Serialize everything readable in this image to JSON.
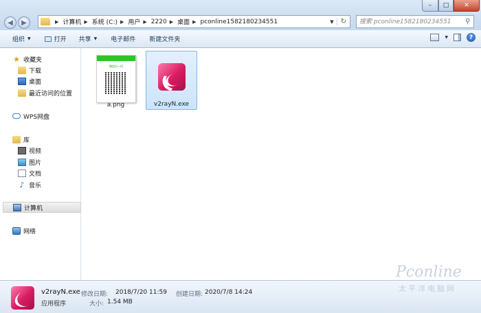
{
  "window": {
    "controls": {
      "minimize": "–",
      "maximize": "□",
      "close": "✕"
    }
  },
  "address_bar": {
    "crumbs": [
      "计算机",
      "系统 (C:)",
      "用户",
      "2220",
      "桌面",
      "pconline1582180234551"
    ]
  },
  "search": {
    "placeholder": "搜索 pconline1582180234551"
  },
  "toolbar": {
    "organize": "组织",
    "open": "打开",
    "share": "共享",
    "email": "电子邮件",
    "new_folder": "新建文件夹"
  },
  "nav": {
    "favorites": "收藏夹",
    "downloads": "下载",
    "desktop": "桌面",
    "recent": "最近访问的位置",
    "wps": "WPS网盘",
    "libraries": "库",
    "videos": "视频",
    "pictures": "图片",
    "documents": "文档",
    "music": "音乐",
    "computer": "计算机",
    "network": "网络"
  },
  "files": [
    {
      "name": "a.png",
      "thumb_title": "微信扫一扫"
    },
    {
      "name": "v2rayN.exe"
    }
  ],
  "details": {
    "name": "v2rayN.exe",
    "type": "应用程序",
    "modified_label": "修改日期:",
    "modified_value": "2018/7/20 11:59",
    "created_label": "创建日期:",
    "created_value": "2020/7/8 14:24",
    "size_label": "大小:",
    "size_value": "1.54 MB"
  },
  "watermark": {
    "brand": "Pconline",
    "sub": "太平洋电脑网"
  },
  "colors": {
    "accent": "#d81b60",
    "selection": "#cde4fb",
    "toolbar_text": "#1e395b"
  }
}
